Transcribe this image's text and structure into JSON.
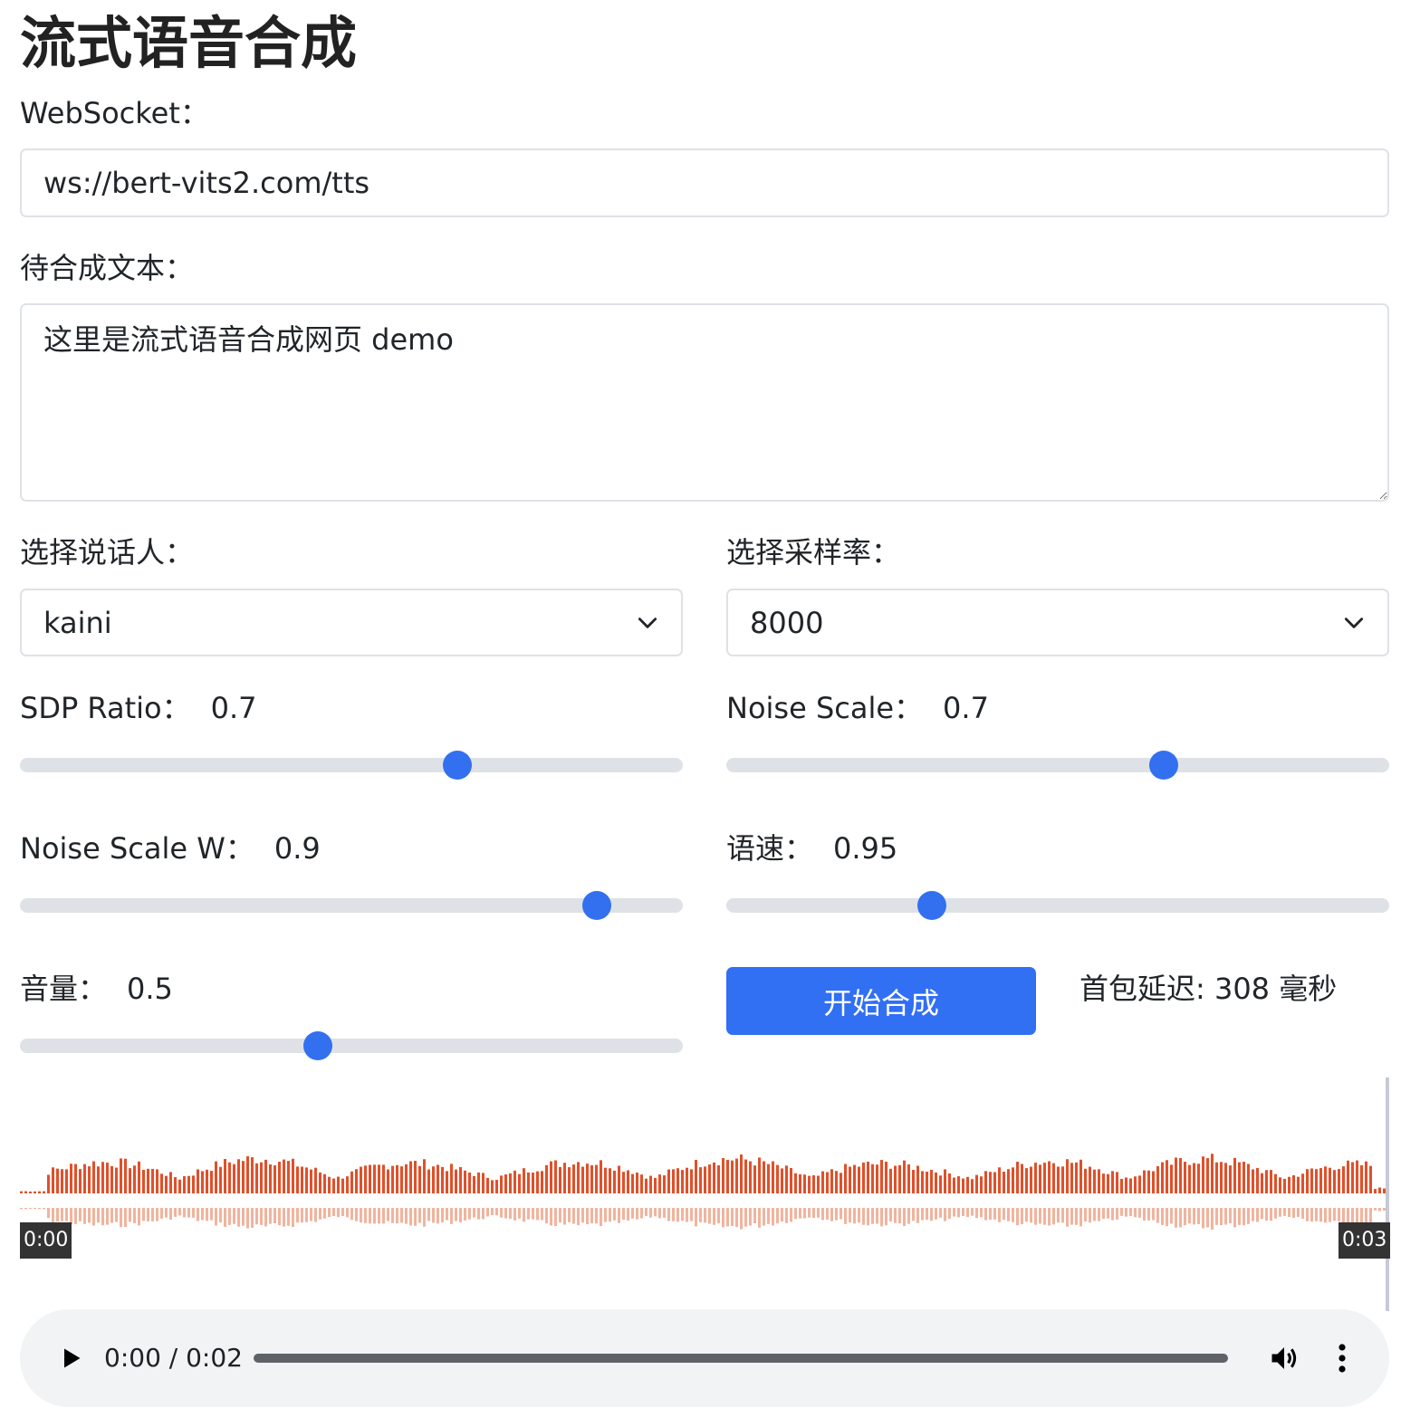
{
  "page": {
    "title": "流式语音合成"
  },
  "websocket": {
    "label": "WebSocket：",
    "value": "ws://bert-vits2.com/tts"
  },
  "text_input": {
    "label": "待合成文本：",
    "value": "这里是流式语音合成网页 demo"
  },
  "speaker": {
    "label": "选择说话人：",
    "value": "kaini"
  },
  "sample_rate": {
    "label": "选择采样率：",
    "value": "8000"
  },
  "sliders": {
    "sdp_ratio": {
      "label": "SDP Ratio：",
      "value": "0.7",
      "fraction": 0.66
    },
    "noise_scale": {
      "label": "Noise Scale：",
      "value": "0.7",
      "fraction": 0.66
    },
    "noise_scale_w": {
      "label": "Noise Scale W：",
      "value": "0.9",
      "fraction": 0.87
    },
    "speed": {
      "label": "语速：",
      "value": "0.95",
      "fraction": 0.31
    },
    "volume": {
      "label": "音量：",
      "value": "0.5",
      "fraction": 0.45
    }
  },
  "start_button": {
    "label": "开始合成"
  },
  "latency": {
    "text": "首包延迟: 308 毫秒"
  },
  "waveform": {
    "start_time": "0:00",
    "end_time": "0:03",
    "wave_color": "#e0502a",
    "reflection_color": "#f0b49e"
  },
  "player": {
    "time": "0:00 / 0:02"
  },
  "colors": {
    "accent": "#316ff3",
    "track": "#dee2e6"
  }
}
